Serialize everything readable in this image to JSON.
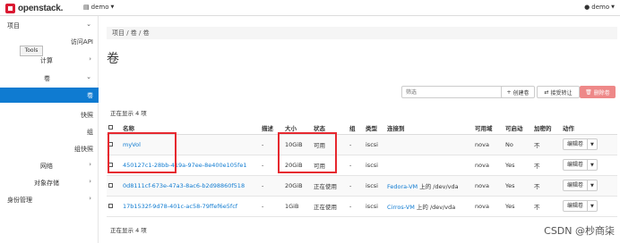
{
  "topbar": {
    "brand": "openstack.",
    "project": "demo",
    "user": "demo"
  },
  "sidebar": {
    "tooltip": "Tools",
    "items": [
      {
        "label": "项目",
        "chevron": "chevron-down"
      },
      {
        "label": "访问API"
      },
      {
        "label": "计算",
        "chevron": "chevron-right"
      },
      {
        "label": "卷",
        "chevron": "chevron-down"
      },
      {
        "label": "卷",
        "active": true
      },
      {
        "label": "快照"
      },
      {
        "label": "组"
      },
      {
        "label": "组快照"
      },
      {
        "label": "网络",
        "chevron": "chevron-right"
      },
      {
        "label": "对象存储",
        "chevron": "chevron-right"
      },
      {
        "label": "身份管理",
        "chevron": "chevron-right"
      }
    ]
  },
  "main": {
    "breadcrumb": "项目 / 卷 / 卷",
    "title": "卷",
    "filter_placeholder": "筛选",
    "create_btn": "创建卷",
    "accept_btn": "接受转让",
    "delete_btn": "删除卷",
    "count_top": "正在显示 4 项",
    "count_bottom": "正在显示 4 项",
    "columns": [
      "名称",
      "描述",
      "大小",
      "状态",
      "组",
      "类型",
      "连接到",
      "可用域",
      "可启动",
      "加密的",
      "动作"
    ],
    "rows": [
      {
        "name": "myVol",
        "desc": "-",
        "size": "10GiB",
        "status": "可用",
        "group": "-",
        "type": "iscsi",
        "attached": "",
        "az": "nova",
        "bootable": "No",
        "encrypted": "不",
        "action": "编辑卷"
      },
      {
        "name": "450127c1-28bb-419a-97ee-8e400e105fe1",
        "desc": "-",
        "size": "20GiB",
        "status": "可用",
        "group": "-",
        "type": "iscsi",
        "attached": "",
        "az": "nova",
        "bootable": "Yes",
        "encrypted": "不",
        "action": "编辑卷"
      },
      {
        "name": "0d8111cf-673e-47a3-8ac6-b2d98860f518",
        "desc": "-",
        "size": "20GiB",
        "status": "正在使用",
        "group": "-",
        "type": "iscsi",
        "attached_link": "Fedora-VM",
        "attached_suffix": " 上的 /dev/vda",
        "az": "nova",
        "bootable": "Yes",
        "encrypted": "不",
        "action": "编辑卷"
      },
      {
        "name": "17b1532f-9d78-401c-ac58-79ffef6e5fcf",
        "desc": "-",
        "size": "1GiB",
        "status": "正在使用",
        "group": "-",
        "type": "iscsi",
        "attached_link": "Cirros-VM",
        "attached_suffix": " 上的 /dev/vda",
        "az": "nova",
        "bootable": "Yes",
        "encrypted": "不",
        "action": "编辑卷"
      }
    ]
  },
  "watermark": "CSDN @杪商柒",
  "colors": {
    "accent": "#0f7bd1",
    "brand": "#da1a32",
    "highlight": "#e6282f",
    "danger": "#e88888"
  }
}
